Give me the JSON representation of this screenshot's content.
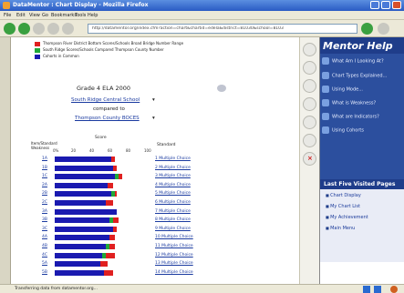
{
  "window": {
    "title": "DataMentor : Chart Display - Mozilla Firefox"
  },
  "menu": [
    "File",
    "Edit",
    "View",
    "Go",
    "Bookmarks",
    "Tools",
    "Help"
  ],
  "url": "http://datamentor.org/index.cfm?action=chart&chartid=edela&district=81030&school=8103",
  "legend": [
    {
      "label": "Thompson River District Bottom Scores/Schools Broad Bridge Number Range",
      "color": "#e02020"
    },
    {
      "label": "South Ridge Scores/Schools Compared Thompson County Number",
      "color": "#1fa83a"
    },
    {
      "label": "Cohorts in Common",
      "color": "#1a1ab0"
    }
  ],
  "report": {
    "title": "Grade 4 ELA 2000",
    "school": "South Ridge Central School",
    "compared_to": "compared to",
    "county": "Thompson County BOCES",
    "col_header_left": "Item/Standard Weakness",
    "col_header_right": "Standard",
    "axis_top": "Score",
    "ticks": [
      "0%",
      "20",
      "40",
      "60",
      "80",
      "100"
    ]
  },
  "chart_data": {
    "type": "bar",
    "categories": [
      "1A",
      "1B",
      "1C",
      "2A",
      "2B",
      "2C",
      "3A",
      "3B",
      "3C",
      "4A",
      "4B",
      "4C",
      "5A",
      "5B"
    ],
    "series": [
      {
        "name": "Cohorts in Common",
        "color": "#1a1ab0",
        "values": [
          62,
          64,
          66,
          58,
          62,
          56,
          68,
          60,
          64,
          60,
          56,
          52,
          50,
          54
        ]
      },
      {
        "name": "South Ridge",
        "color": "#1fa83a",
        "values": [
          0,
          0,
          4,
          0,
          4,
          0,
          0,
          4,
          0,
          0,
          4,
          4,
          0,
          0
        ]
      },
      {
        "name": "Thompson River",
        "color": "#e02020",
        "values": [
          4,
          4,
          4,
          6,
          2,
          8,
          0,
          6,
          4,
          6,
          6,
          10,
          8,
          10
        ]
      }
    ],
    "row_labels": [
      "1 Multiple Choice",
      "2 Multiple Choice",
      "3 Multiple Choice",
      "4 Multiple Choice",
      "5 Multiple Choice",
      "6 Multiple Choice",
      "7 Multiple Choice",
      "8 Multiple Choice",
      "9 Multiple Choice",
      "10 Multiple Choice",
      "11 Multiple Choice",
      "12 Multiple Choice",
      "13 Multiple Choice",
      "14 Multiple Choice"
    ],
    "ylim": [
      0,
      100
    ]
  },
  "sidebar": {
    "title": "Mentor Help",
    "items": [
      "What Am I Looking At?",
      "Chart Types Explained...",
      "Using Mode...",
      "What is Weakness?",
      "What are Indicators?",
      "Using Cohorts"
    ],
    "last_five_title": "Last Five Visited Pages",
    "last_five": [
      "Chart Display",
      "My Chart List",
      "My Achievement",
      "Main Menu"
    ]
  },
  "status": "Transferring data from datamentor.org..."
}
